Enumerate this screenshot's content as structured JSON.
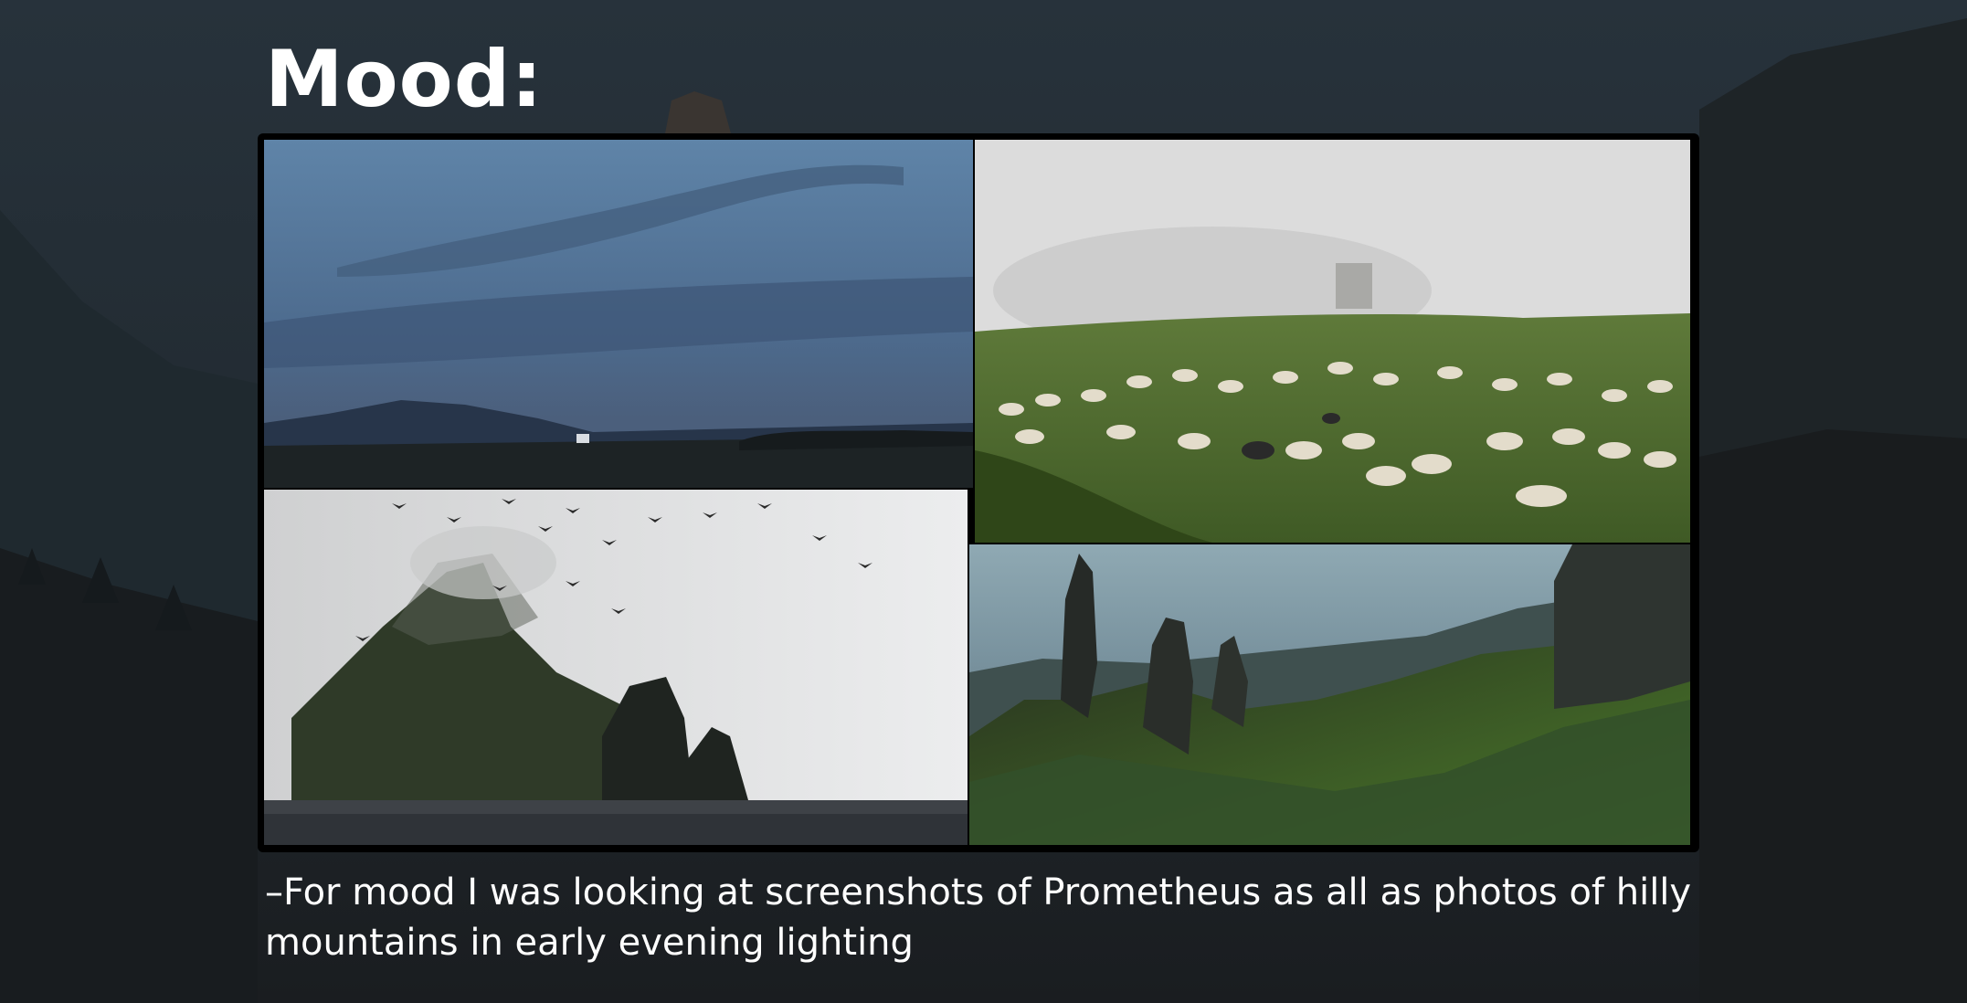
{
  "slide": {
    "title": "Mood:",
    "caption": "–For mood I was looking at screenshots of Prometheus as all as photos of hilly mountains in early evening lighting",
    "background_color": "#1b1f23",
    "text_color": "#ffffff"
  },
  "collage": {
    "border_color": "#000000",
    "photos": [
      "dusk sky over hills",
      "sheep flock on foggy hill",
      "misty sea island with birds",
      "rock spires on green hills"
    ]
  }
}
